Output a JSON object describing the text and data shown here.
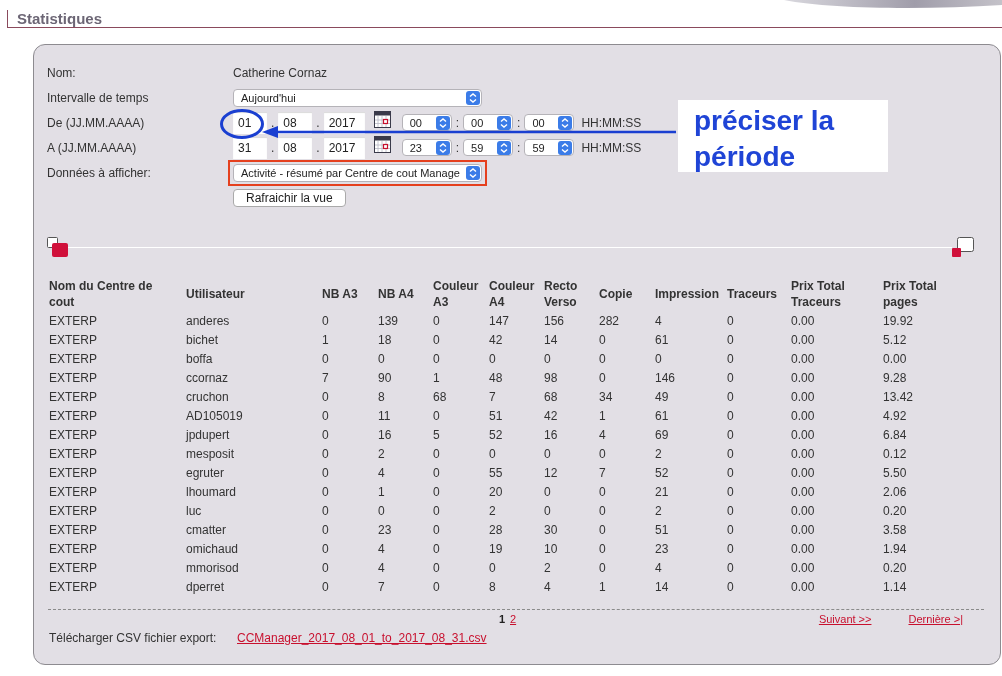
{
  "header": {
    "title": "Statistiques"
  },
  "form": {
    "name": {
      "label": "Nom:",
      "value": "Catherine Cornaz"
    },
    "interval": {
      "label": "Intervalle de temps",
      "value": "Aujourd'hui"
    },
    "date_rows": [
      {
        "label": "De (JJ.MM.AAAA)",
        "parts": [
          {
            "kind": "field",
            "value": "01"
          },
          {
            "kind": "separator",
            "text": "."
          },
          {
            "kind": "field",
            "value": "08"
          },
          {
            "kind": "separator",
            "text": "."
          },
          {
            "kind": "field",
            "value": "2017"
          },
          {
            "kind": "calendar"
          },
          {
            "kind": "select",
            "value": "00"
          },
          {
            "kind": "separator",
            "text": ":"
          },
          {
            "kind": "select",
            "value": "00"
          },
          {
            "kind": "separator",
            "text": ":"
          },
          {
            "kind": "select",
            "value": "00"
          },
          {
            "kind": "hint",
            "text": "HH:MM:SS"
          }
        ]
      },
      {
        "label": "A (JJ.MM.AAAA)",
        "parts": [
          {
            "kind": "field",
            "value": "31"
          },
          {
            "kind": "separator",
            "text": "."
          },
          {
            "kind": "field",
            "value": "08"
          },
          {
            "kind": "separator",
            "text": "."
          },
          {
            "kind": "field",
            "value": "2017"
          },
          {
            "kind": "calendar"
          },
          {
            "kind": "select",
            "value": "23"
          },
          {
            "kind": "separator",
            "text": ":"
          },
          {
            "kind": "select",
            "value": "59"
          },
          {
            "kind": "separator",
            "text": ":"
          },
          {
            "kind": "select",
            "value": "59"
          },
          {
            "kind": "hint",
            "text": "HH:MM:SS"
          }
        ]
      }
    ],
    "display": {
      "label": "Données à afficher:",
      "value": "Activité - résumé par Centre de cout Manage",
      "highlighted": true
    },
    "refresh_button": "Rafraichir la vue"
  },
  "annotation": {
    "text": "préciser la période"
  },
  "table": {
    "columns": [
      "Nom du Centre de cout",
      "Utilisateur",
      "NB A3",
      "NB A4",
      "Couleur A3",
      "Couleur A4",
      "Recto Verso",
      "Copie",
      "Impression",
      "Traceurs",
      "Prix Total Traceurs",
      "Prix Total pages"
    ],
    "rows": [
      [
        "EXTERP",
        "anderes",
        "0",
        "139",
        "0",
        "147",
        "156",
        "282",
        "4",
        "0",
        "0.00",
        "19.92"
      ],
      [
        "EXTERP",
        "bichet",
        "1",
        "18",
        "0",
        "42",
        "14",
        "0",
        "61",
        "0",
        "0.00",
        "5.12"
      ],
      [
        "EXTERP",
        "boffa",
        "0",
        "0",
        "0",
        "0",
        "0",
        "0",
        "0",
        "0",
        "0.00",
        "0.00"
      ],
      [
        "EXTERP",
        "ccornaz",
        "7",
        "90",
        "1",
        "48",
        "98",
        "0",
        "146",
        "0",
        "0.00",
        "9.28"
      ],
      [
        "EXTERP",
        "cruchon",
        "0",
        "8",
        "68",
        "7",
        "68",
        "34",
        "49",
        "0",
        "0.00",
        "13.42"
      ],
      [
        "EXTERP",
        "AD105019",
        "0",
        "11",
        "0",
        "51",
        "42",
        "1",
        "61",
        "0",
        "0.00",
        "4.92"
      ],
      [
        "EXTERP",
        "jpdupert",
        "0",
        "16",
        "5",
        "52",
        "16",
        "4",
        "69",
        "0",
        "0.00",
        "6.84"
      ],
      [
        "EXTERP",
        "mesposit",
        "0",
        "2",
        "0",
        "0",
        "0",
        "0",
        "2",
        "0",
        "0.00",
        "0.12"
      ],
      [
        "EXTERP",
        "egruter",
        "0",
        "4",
        "0",
        "55",
        "12",
        "7",
        "52",
        "0",
        "0.00",
        "5.50"
      ],
      [
        "EXTERP",
        "lhoumard",
        "0",
        "1",
        "0",
        "20",
        "0",
        "0",
        "21",
        "0",
        "0.00",
        "2.06"
      ],
      [
        "EXTERP",
        "luc",
        "0",
        "0",
        "0",
        "2",
        "0",
        "0",
        "2",
        "0",
        "0.00",
        "0.20"
      ],
      [
        "EXTERP",
        "cmatter",
        "0",
        "23",
        "0",
        "28",
        "30",
        "0",
        "51",
        "0",
        "0.00",
        "3.58"
      ],
      [
        "EXTERP",
        "omichaud",
        "0",
        "4",
        "0",
        "19",
        "10",
        "0",
        "23",
        "0",
        "0.00",
        "1.94"
      ],
      [
        "EXTERP",
        "mmorisod",
        "0",
        "4",
        "0",
        "0",
        "2",
        "0",
        "4",
        "0",
        "0.00",
        "0.20"
      ],
      [
        "EXTERP",
        "dperret",
        "0",
        "7",
        "0",
        "8",
        "4",
        "1",
        "14",
        "0",
        "0.00",
        "1.14"
      ]
    ]
  },
  "pagination": {
    "pages": [
      {
        "label": "1",
        "selected": true
      },
      {
        "label": "2",
        "selected": false
      }
    ],
    "next": "Suivant >>",
    "last": "Dernière >|"
  },
  "export": {
    "label": "Télécharger CSV fichier export:",
    "link": "CCManager_2017_08_01_to_2017_08_31.csv"
  }
}
